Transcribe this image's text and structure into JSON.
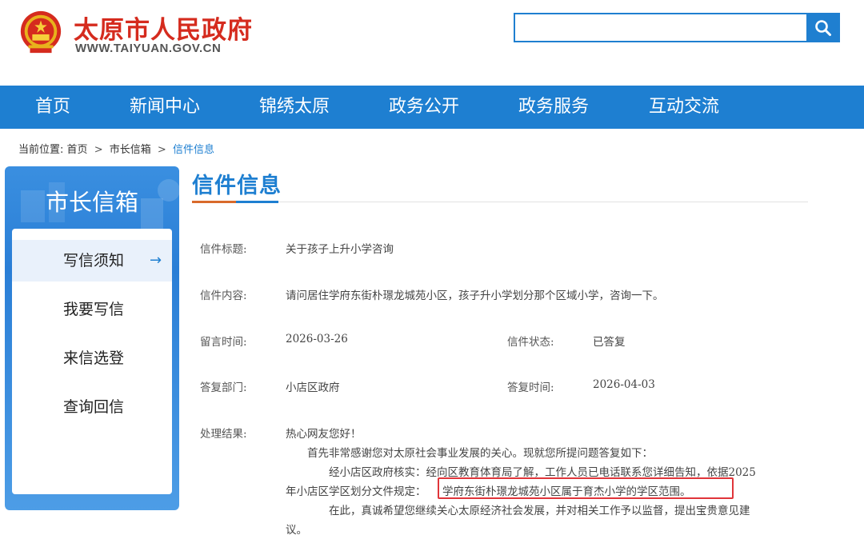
{
  "header": {
    "site_title": "太原市人民政府",
    "site_domain": "WWW.TAIYUAN.GOV.CN",
    "search_placeholder": ""
  },
  "nav": {
    "items": [
      {
        "label": "首页"
      },
      {
        "label": "新闻中心"
      },
      {
        "label": "锦绣太原"
      },
      {
        "label": "政务公开"
      },
      {
        "label": "政务服务"
      },
      {
        "label": "互动交流"
      }
    ]
  },
  "breadcrumb": {
    "prefix": "当前位置:",
    "items": [
      "首页",
      "市长信箱",
      "信件信息"
    ],
    "separator": ">"
  },
  "sidebar": {
    "title": "市长信箱",
    "items": [
      {
        "label": "写信须知",
        "active": true
      },
      {
        "label": "我要写信"
      },
      {
        "label": "来信选登"
      },
      {
        "label": "查询回信"
      }
    ]
  },
  "content": {
    "title": "信件信息",
    "fields": {
      "subject_label": "信件标题:",
      "subject_value": "关于孩子上升小学咨询",
      "body_label": "信件内容:",
      "body_value": "请问居住学府东街朴璟龙城苑小区，孩子升小学划分那个区域小学，咨询一下。",
      "time_label": "留言时间:",
      "time_value": "2026-03-26",
      "status_label": "信件状态:",
      "status_value": "已答复",
      "dept_label": "答复部门:",
      "dept_value": "小店区政府",
      "reply_time_label": "答复时间:",
      "reply_time_value": "2026-04-03",
      "result_label": "处理结果:"
    },
    "reply_lines": [
      "热心网友您好！",
      "首先非常感谢您对太原社会事业发展的关心。现就您所提问题答复如下：",
      "经小店区政府核实：经向区教育体育局了解，工作人员已电话联系您详细告知，依据2025",
      "年小店区学区划分文件规定：",
      "学府东街朴璟龙城苑小区属于育杰小学的学区范围。",
      "在此，真诚希望您继续关心太原经济社会发展，并对相关工作予以监督，提出宝贵意见建",
      "议。"
    ]
  },
  "colors": {
    "primary_blue": "#1e7fd1",
    "brand_red": "#d52b1e",
    "highlight_red": "#e0353a"
  },
  "icons": {
    "search": "search-icon",
    "arrow": "arrow-right-icon",
    "emblem": "national-emblem-icon"
  }
}
